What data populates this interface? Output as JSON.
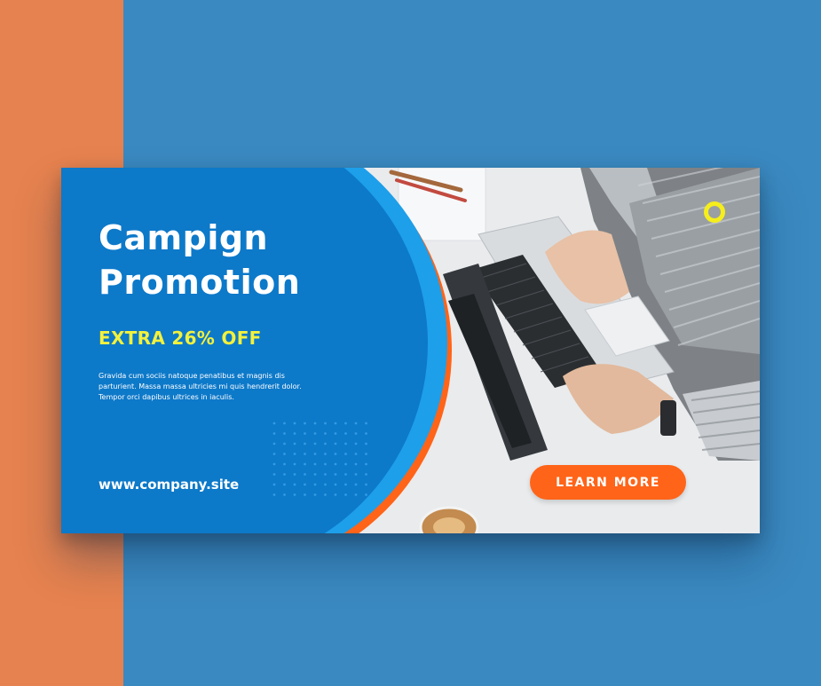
{
  "banner": {
    "headline_line1": "Campign",
    "headline_line2": "Promotion",
    "offer": "EXTRA 26% OFF",
    "body": "Gravida cum sociis natoque penatibus et magnis dis parturient. Massa massa ultricies mi quis hendrerit dolor. Tempor orci dapibus ultrices in iaculis.",
    "website": "www.company.site",
    "cta_label": "LEARN MORE"
  },
  "colors": {
    "background": "#3a89c0",
    "side_strip": "#e5824f",
    "panel_blue": "#0d79c9",
    "arc_light_blue": "#1d9fea",
    "arc_orange": "#ff6418",
    "offer_yellow": "#f3f13d",
    "ring_yellow": "#f5ee1c",
    "cta_orange": "#ff6418"
  },
  "icons": {
    "decor_ring": "ring-icon",
    "dot_grid": "dot-grid-pattern"
  }
}
